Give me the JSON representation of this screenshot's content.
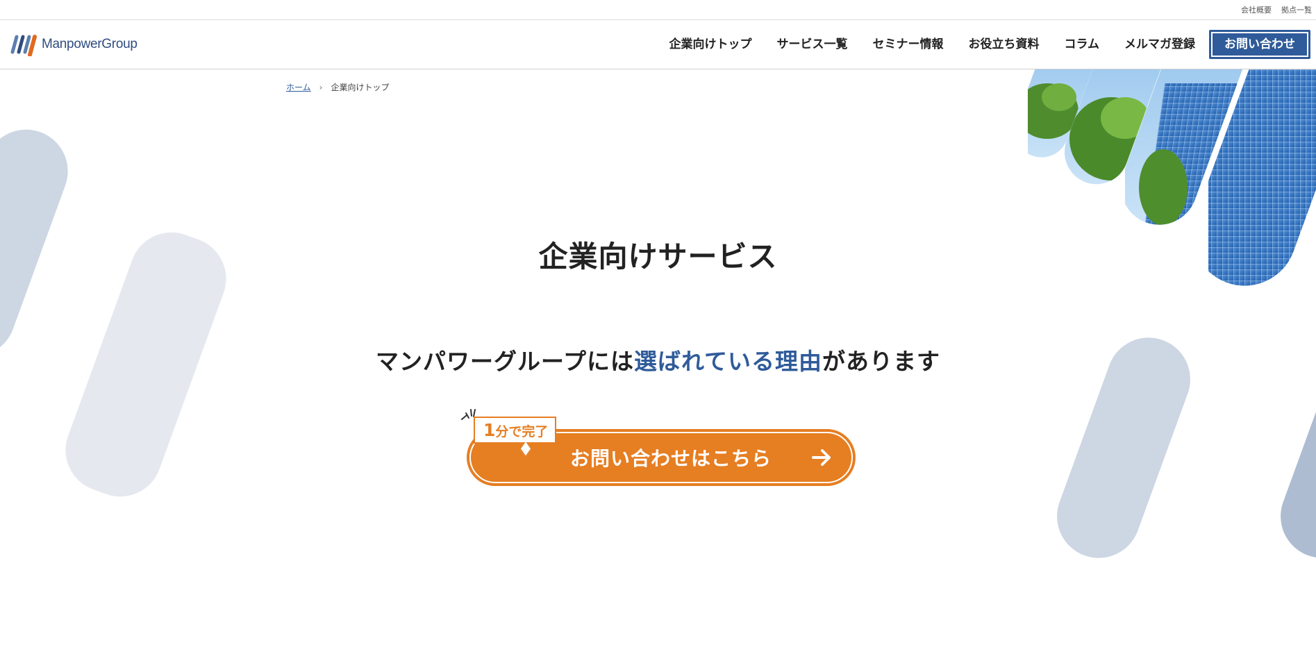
{
  "utility_links": [
    "会社概要",
    "拠点一覧"
  ],
  "brand": {
    "name": "ManpowerGroup"
  },
  "nav": {
    "items": [
      "企業向けトップ",
      "サービス一覧",
      "セミナー情報",
      "お役立ち資料",
      "コラム",
      "メルマガ登録"
    ],
    "cta": "お問い合わせ"
  },
  "breadcrumb": {
    "home": "ホーム",
    "current": "企業向けトップ"
  },
  "hero": {
    "title": "企業向けサービス",
    "tagline_pre": "マンパワーグループには",
    "tagline_highlight": "選ばれている理由",
    "tagline_post": "があります"
  },
  "cta": {
    "badge_number": "1",
    "badge_text": "分で完了",
    "label": "お問い合わせはこちら"
  },
  "colors": {
    "brand_blue": "#2f5b9a",
    "accent_orange": "#e67e22",
    "pill_light": "#e5e9ef",
    "pill_mid": "#cdd6e3"
  }
}
